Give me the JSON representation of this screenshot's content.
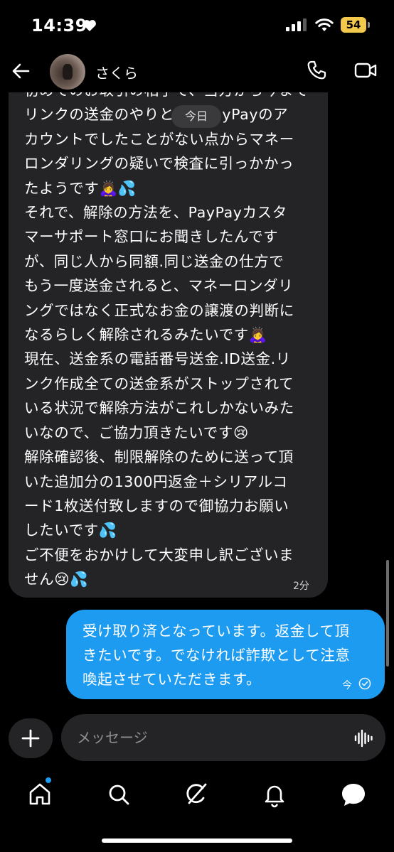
{
  "status_bar": {
    "time": "14:39",
    "battery_level": "54"
  },
  "header": {
    "contact_name": "さくら"
  },
  "messages": {
    "date_label": "今日",
    "received": {
      "text": "初めてのお取引の相手で、当方から今まで\nリンクの送金のやりとり　PayPayのア\nカウントでしたことがない点からマネー\nロンダリングの疑いで検査に引っかかっ\nたようです🙇‍♀️💦\nそれで、解除の方法を、PayPayカスタ\nマーサポート窓口にお聞きしたんです\nが、同じ人から同額.同じ送金の仕方で\nもう一度送金されると、マネーロンダリ\nングではなく正式なお金の譲渡の判断に\nなるらしく解除されるみたいです🙇‍♀️\n現在、送金系の電話番号送金.ID送金.リ\nンク作成全ての送金系がストップされて\nいる状況で解除方法がこれしかないみた\nいなので、ご協力頂きたいです😢\n解除確認後、制限解除のために送って頂\nいた追加分の1300円返金＋シリアルコ\nード1枚送付致しますので御協力お願い\nしたいです💦\nご不便をおかけして大変申し訳ございま\nせん😢💦",
      "time": "2分"
    },
    "sent": {
      "text": "受け取り済となっています。返金して頂\nきたいです。でなければ詐欺として注意\n喚起させていただきます。",
      "time": "今"
    }
  },
  "composer": {
    "placeholder": "メッセージ"
  },
  "tab_bar": {
    "items": [
      "home-icon",
      "search-icon",
      "grok-icon",
      "notifications-icon",
      "messages-icon"
    ],
    "active": "messages-icon"
  },
  "colors": {
    "background": "#000000",
    "received_bubble": "#242426",
    "sent_bubble": "#1d9bf0",
    "battery": "#f2c94c"
  }
}
